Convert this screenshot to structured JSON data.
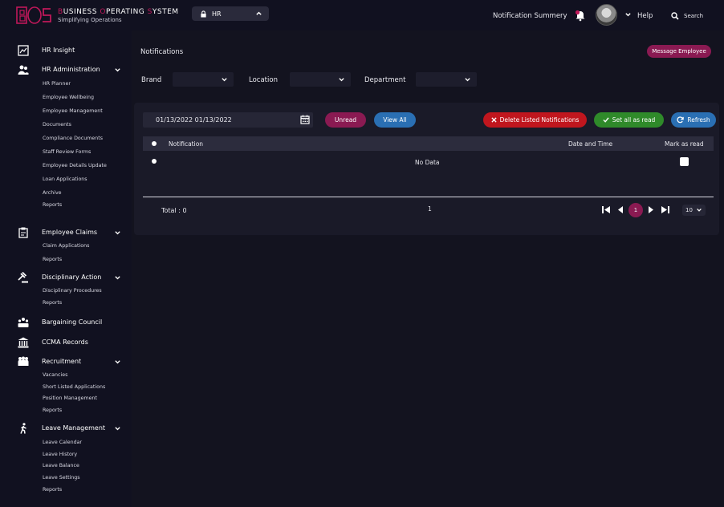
{
  "app": {
    "brand_first": [
      "B",
      "O",
      "S"
    ],
    "brand_rest": [
      "USINESS ",
      "PERATING ",
      "YSTEM"
    ],
    "tagline": "Simplifying Operations",
    "module": "HR"
  },
  "header": {
    "notification_summary": "Notification Summery",
    "help": "Help",
    "search": "Search"
  },
  "sidebar": {
    "hr_insight": "HR Insight",
    "hr_administration": {
      "label": "HR Administration",
      "items": [
        "HR Planner",
        "Employee Wellbeing",
        "Employee Management",
        "Documents",
        "Compliance Documents",
        "Staff Review Forms",
        "Employee Details Update",
        "Loan Applications",
        "Archive",
        "Reports"
      ]
    },
    "employee_claims": {
      "label": "Employee Claims",
      "items": [
        "Claim Applications",
        "Reports"
      ]
    },
    "disciplinary_action": {
      "label": "Disciplinary Action",
      "items": [
        "Disciplinary Procedures",
        "Reports"
      ]
    },
    "bargaining_council": "Bargaining Council",
    "ccma_records": "CCMA Records",
    "recruitment": {
      "label": "Recruitment",
      "items": [
        "Vacancies",
        "Short Listed Applications",
        "Position Management",
        "Reports"
      ]
    },
    "leave_management": {
      "label": "Leave Management",
      "items": [
        "Leave Calendar",
        "Leave History",
        "Leave Balance",
        "Leave Settings",
        "Reports"
      ]
    }
  },
  "page": {
    "title": "Notifications",
    "message_employee": "Message Employee"
  },
  "filters": {
    "brand": "Brand",
    "location": "Location",
    "department": "Department"
  },
  "toolbar": {
    "date_range": "01/13/2022 01/13/2022",
    "unread": "Unread",
    "view_all": "View All",
    "delete_listed": "Delete Listed Notifications",
    "set_all_read": "Set all as read",
    "refresh": "Refresh"
  },
  "table": {
    "col_notification": "Notification",
    "col_date_time": "Date and Time",
    "col_mark_read": "Mark as read",
    "empty": "No Data"
  },
  "footer": {
    "total": "Total : 0",
    "page_count": "1",
    "current_page": "1",
    "page_size": "10"
  },
  "colors": {
    "accent": "#8a1a52",
    "danger": "#c0161e",
    "success": "#2f8a2a",
    "info": "#2a6fb3"
  }
}
